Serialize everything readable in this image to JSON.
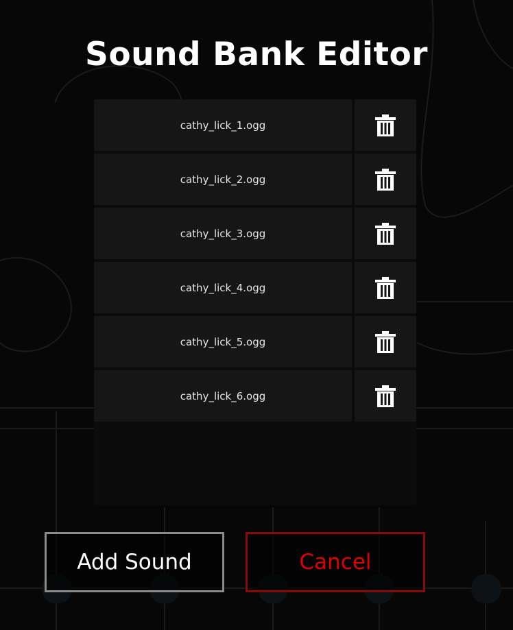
{
  "dialog": {
    "title": "Sound Bank Editor"
  },
  "sounds": [
    {
      "name": "cathy_lick_1.ogg"
    },
    {
      "name": "cathy_lick_2.ogg"
    },
    {
      "name": "cathy_lick_3.ogg"
    },
    {
      "name": "cathy_lick_4.ogg"
    },
    {
      "name": "cathy_lick_5.ogg"
    },
    {
      "name": "cathy_lick_6.ogg"
    }
  ],
  "row_delete_icon": "trash-icon",
  "buttons": {
    "add_label": "Add Sound",
    "cancel_label": "Cancel"
  },
  "colors": {
    "background": "#070707",
    "row": "#161616",
    "cancel_text": "#e00000",
    "cancel_border": "#8a0a0a",
    "add_border": "#8a8a8a"
  }
}
